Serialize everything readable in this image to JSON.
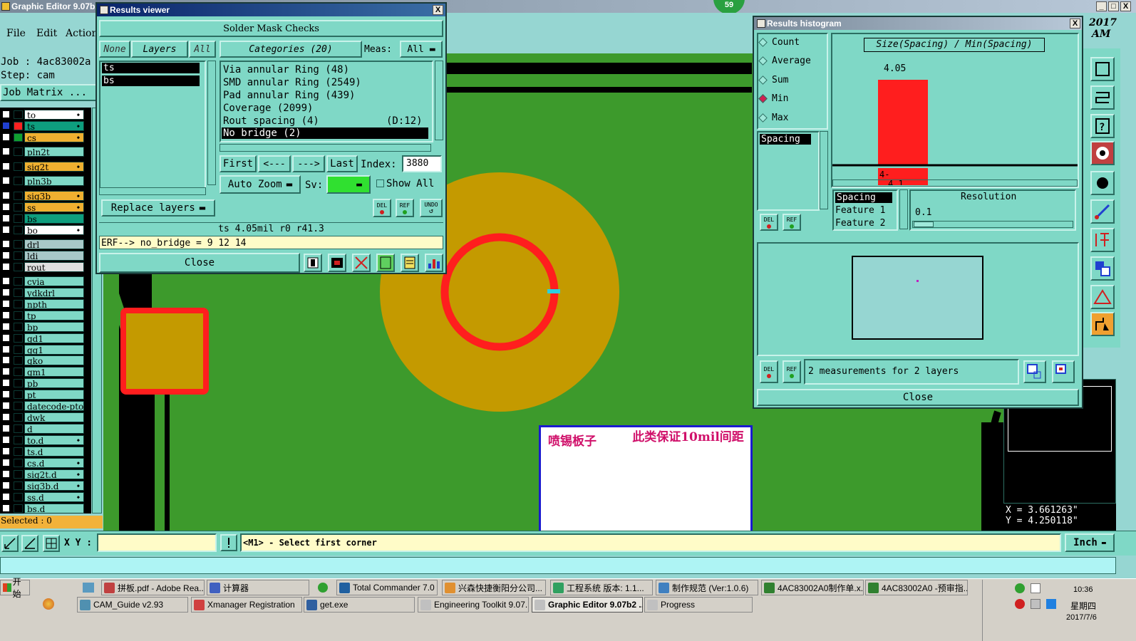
{
  "app": {
    "title": "Graphic Editor 9.07b2",
    "menu": [
      "File",
      "Edit",
      "Action"
    ],
    "job_label": "Job : 4ac83002a",
    "step_label": "Step: cam",
    "job_matrix": "Job Matrix ...",
    "clock_line1": "2017",
    "clock_line2": "AM",
    "badge": "59"
  },
  "layers": [
    {
      "name": "to",
      "color": "#ffffff",
      "swatch": ""
    },
    {
      "name": "ts",
      "color": "#0e9e7e",
      "swatch": "#ff2020"
    },
    {
      "name": "cs",
      "color": "#f0b030",
      "swatch": "#10a030"
    },
    {
      "name": "pln2t",
      "color": "#7fd8c6",
      "swatch": ""
    },
    {
      "name": "sig2t",
      "color": "#f0b030",
      "swatch": ""
    },
    {
      "name": "pln3b",
      "color": "#7fd8c6",
      "swatch": ""
    },
    {
      "name": "sig3b",
      "color": "#f0b030",
      "swatch": ""
    },
    {
      "name": "ss",
      "color": "#f0b030",
      "swatch": ""
    },
    {
      "name": "bs",
      "color": "#0e9e7e",
      "swatch": ""
    },
    {
      "name": "bo",
      "color": "#ffffff",
      "swatch": ""
    },
    {
      "name": "drl",
      "color": "#a8c8c8",
      "swatch": ""
    },
    {
      "name": "ldi",
      "color": "#a8c8c8",
      "swatch": ""
    },
    {
      "name": "rout",
      "color": "#e0e0e0",
      "swatch": ""
    },
    {
      "name": "cvia",
      "color": "#7fd8c6",
      "swatch": ""
    },
    {
      "name": "ydkdrl",
      "color": "#7fd8c6",
      "swatch": ""
    },
    {
      "name": "npth",
      "color": "#7fd8c6",
      "swatch": ""
    },
    {
      "name": "tp",
      "color": "#7fd8c6",
      "swatch": ""
    },
    {
      "name": "bp",
      "color": "#7fd8c6",
      "swatch": ""
    },
    {
      "name": "gd1",
      "color": "#7fd8c6",
      "swatch": ""
    },
    {
      "name": "gg1",
      "color": "#7fd8c6",
      "swatch": ""
    },
    {
      "name": "gko",
      "color": "#7fd8c6",
      "swatch": ""
    },
    {
      "name": "gm1",
      "color": "#7fd8c6",
      "swatch": ""
    },
    {
      "name": "pb",
      "color": "#7fd8c6",
      "swatch": ""
    },
    {
      "name": "pt",
      "color": "#7fd8c6",
      "swatch": ""
    },
    {
      "name": "datecode-pto",
      "color": "#7fd8c6",
      "swatch": ""
    },
    {
      "name": "dwk",
      "color": "#7fd8c6",
      "swatch": ""
    },
    {
      "name": "d",
      "color": "#7fd8c6",
      "swatch": ""
    },
    {
      "name": "to.d",
      "color": "#7fd8c6",
      "swatch": ""
    },
    {
      "name": "ts.d",
      "color": "#7fd8c6",
      "swatch": ""
    },
    {
      "name": "cs.d",
      "color": "#7fd8c6",
      "swatch": ""
    },
    {
      "name": "sig2t.d",
      "color": "#7fd8c6",
      "swatch": ""
    },
    {
      "name": "sig3b.d",
      "color": "#7fd8c6",
      "swatch": ""
    },
    {
      "name": "ss.d",
      "color": "#7fd8c6",
      "swatch": ""
    },
    {
      "name": "bs.d",
      "color": "#7fd8c6",
      "swatch": ""
    }
  ],
  "selected": "Selected : 0",
  "results_viewer": {
    "title": "Results viewer",
    "header": "Solder Mask Checks",
    "none": "None",
    "layers": "Layers",
    "all": "All",
    "categories": "Categories (20)",
    "meas_label": "Meas:",
    "meas_value": "All",
    "layer_list": [
      "ts",
      "bs"
    ],
    "category_list": [
      "Via annular Ring (48)",
      "SMD annular Ring (2549)",
      "Pad annular Ring (439)",
      "Coverage (2099)",
      "Rout spacing (4)",
      "No bridge (2)"
    ],
    "rout_extra": "(D:12)",
    "first": "First",
    "prev": "<---",
    "next": "--->",
    "last": "Last",
    "index_label": "Index:",
    "index_value": "3880",
    "replace_layers": "Replace layers",
    "auto_zoom": "Auto Zoom",
    "sv_label": "Sv:",
    "show_all": "Show All",
    "del": "DEL",
    "ref": "REF",
    "undo": "UNDO",
    "status": "ts 4.05mil  r0  r41.3",
    "erf": "ERF--> no_bridge = 9 12 14",
    "close": "Close"
  },
  "histogram": {
    "title": "Results histogram",
    "options": [
      "Count",
      "Average",
      "Sum",
      "Min",
      "Max"
    ],
    "selected_option": "Min",
    "spacing_item": "Spacing",
    "chart_title": "Size(Spacing) / Min(Spacing)",
    "del": "DEL",
    "ref": "REF",
    "feature_list": [
      "Spacing",
      "Feature 1",
      "Feature 2"
    ],
    "resolution_label": "Resolution",
    "resolution_value": "0.1",
    "measurements": "2 measurements for 2 layers",
    "close": "Close"
  },
  "chart_data": {
    "type": "bar",
    "title": "Size(Spacing) / Min(Spacing)",
    "categories": [
      "4-\n4.1"
    ],
    "top_label": "4.05",
    "values": [
      2
    ],
    "bin_label_line1": "4-",
    "bin_label_line2": "4.1"
  },
  "canvas": {
    "annotation_left": "喷锡板子",
    "annotation_right": "此类保证10mil间距",
    "coord_x": "X = 3.661263\"",
    "coord_y": "Y = 4.250118\""
  },
  "statusbar": {
    "xy_label": "X Y :",
    "xy_value": "",
    "hint": "<M1> - Select first corner",
    "unit": "Inch"
  },
  "taskbar": {
    "start": "开始",
    "row1": [
      "拼板.pdf - Adobe Rea...",
      "计算器",
      "Total Commander 7.0 ...",
      "兴森快捷衡阳分公司...",
      "工程系统  版本: 1.1...",
      "制作规范 (Ver:1.0.6)",
      "4AC83002A0制作单.x...",
      "4AC83002A0 -预审指..."
    ],
    "row2": [
      "CAM_Guide v2.93",
      "Xmanager Registration",
      "get.exe",
      "Engineering Toolkit 9.07...",
      "Graphic Editor 9.07b2 ...",
      "Progress"
    ],
    "time": "10:36",
    "weekday": "星期四",
    "date": "2017/7/6"
  },
  "colors": {
    "panel": "#7fd8c6",
    "board_green": "#3d9a2c",
    "pad_orange": "#c49a00",
    "ring_red": "#ff1e1e",
    "title_blue": "#0a246a"
  }
}
